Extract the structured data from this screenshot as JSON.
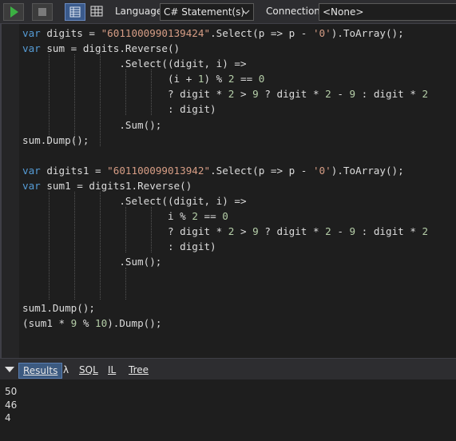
{
  "toolbar": {
    "run_icon": "play-icon",
    "stop_icon": "stop-icon",
    "layout_icon_1": "results-grid-icon",
    "layout_icon_2": "grid-icon",
    "language_label": "Language",
    "language_value": "C# Statement(s)",
    "connection_label": "Connection",
    "connection_value": "<None>",
    "accent_color": "#3a5a8c"
  },
  "editor": {
    "lines": [
      [
        {
          "t": "var",
          "k": "kw"
        },
        {
          "t": " digits = "
        },
        {
          "t": "\"6011000990139424\"",
          "k": "str"
        },
        {
          "t": ".Select(p => p - "
        },
        {
          "t": "'0'",
          "k": "str"
        },
        {
          "t": ").ToArray();"
        }
      ],
      [
        {
          "t": "var",
          "k": "kw"
        },
        {
          "t": " sum = digits.Reverse()"
        }
      ],
      [
        {
          "t": "                .Select((digit, i) =>"
        }
      ],
      [
        {
          "t": "                        (i + "
        },
        {
          "t": "1",
          "k": "num"
        },
        {
          "t": ") % "
        },
        {
          "t": "2",
          "k": "num"
        },
        {
          "t": " == "
        },
        {
          "t": "0",
          "k": "num"
        }
      ],
      [
        {
          "t": "                        ? digit * "
        },
        {
          "t": "2",
          "k": "num"
        },
        {
          "t": " > "
        },
        {
          "t": "9",
          "k": "num"
        },
        {
          "t": " ? digit * "
        },
        {
          "t": "2",
          "k": "num"
        },
        {
          "t": " - "
        },
        {
          "t": "9",
          "k": "num"
        },
        {
          "t": " : digit * "
        },
        {
          "t": "2",
          "k": "num"
        }
      ],
      [
        {
          "t": "                        : digit)"
        }
      ],
      [
        {
          "t": "                .Sum();"
        }
      ],
      [
        {
          "t": "sum.Dump();"
        }
      ],
      [
        {
          "t": ""
        }
      ],
      [
        {
          "t": "var",
          "k": "kw"
        },
        {
          "t": " digits1 = "
        },
        {
          "t": "\"601100099013942\"",
          "k": "str"
        },
        {
          "t": ".Select(p => p - "
        },
        {
          "t": "'0'",
          "k": "str"
        },
        {
          "t": ").ToArray();"
        }
      ],
      [
        {
          "t": "var",
          "k": "kw"
        },
        {
          "t": " sum1 = digits1.Reverse()"
        }
      ],
      [
        {
          "t": "                .Select((digit, i) =>"
        }
      ],
      [
        {
          "t": "                        i % "
        },
        {
          "t": "2",
          "k": "num"
        },
        {
          "t": " == "
        },
        {
          "t": "0",
          "k": "num"
        }
      ],
      [
        {
          "t": "                        ? digit * "
        },
        {
          "t": "2",
          "k": "num"
        },
        {
          "t": " > "
        },
        {
          "t": "9",
          "k": "num"
        },
        {
          "t": " ? digit * "
        },
        {
          "t": "2",
          "k": "num"
        },
        {
          "t": " - "
        },
        {
          "t": "9",
          "k": "num"
        },
        {
          "t": " : digit * "
        },
        {
          "t": "2",
          "k": "num"
        }
      ],
      [
        {
          "t": "                        : digit)"
        }
      ],
      [
        {
          "t": "                .Sum();"
        }
      ],
      [
        {
          "t": ""
        }
      ],
      [
        {
          "t": ""
        }
      ],
      [
        {
          "t": "sum1.Dump();"
        }
      ],
      [
        {
          "t": "(sum1 * "
        },
        {
          "t": "9",
          "k": "num"
        },
        {
          "t": " % "
        },
        {
          "t": "10",
          "k": "num"
        },
        {
          "t": ").Dump();"
        }
      ]
    ]
  },
  "results_tabs": {
    "collapse_icon": "chevron-down-icon",
    "results": "Results",
    "lambda": "λ",
    "sql": "SQL",
    "il": "IL",
    "tree": "Tree"
  },
  "results": {
    "lines": [
      "50",
      "46",
      "4"
    ]
  }
}
